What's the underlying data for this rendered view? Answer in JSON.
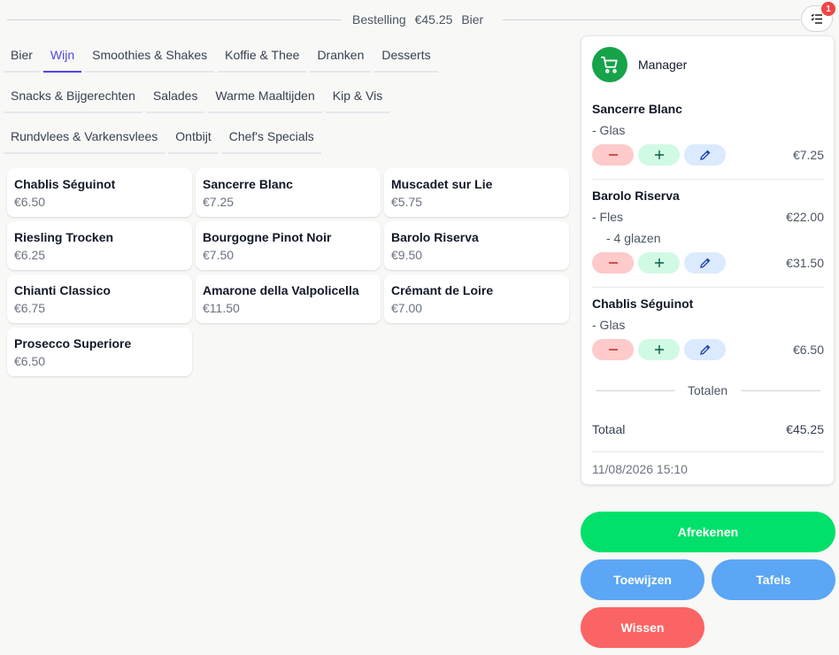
{
  "header": {
    "label": "Bestelling",
    "amount": "€45.25",
    "category": "Bier",
    "badge": "1"
  },
  "tabs": {
    "row1": [
      "Bier",
      "Wijn",
      "Smoothies & Shakes",
      "Koffie & Thee",
      "Dranken",
      "Desserts"
    ],
    "row2": [
      "Snacks & Bijgerechten",
      "Salades",
      "Warme Maaltijden",
      "Kip & Vis"
    ],
    "row3": [
      "Rundvlees & Varkensvlees",
      "Ontbijt",
      "Chef's Specials"
    ],
    "active": "Wijn"
  },
  "products": [
    {
      "name": "Chablis Séguinot",
      "price": "€6.50"
    },
    {
      "name": "Sancerre Blanc",
      "price": "€7.25"
    },
    {
      "name": "Muscadet sur Lie",
      "price": "€5.75"
    },
    {
      "name": "Riesling Trocken",
      "price": "€6.25"
    },
    {
      "name": "Bourgogne Pinot Noir",
      "price": "€7.50"
    },
    {
      "name": "Barolo Riserva",
      "price": "€9.50"
    },
    {
      "name": "Chianti Classico",
      "price": "€6.75"
    },
    {
      "name": "Amarone della Valpolicella",
      "price": "€11.50"
    },
    {
      "name": "Crémant de Loire",
      "price": "€7.00"
    },
    {
      "name": "Prosecco Superiore",
      "price": "€6.50"
    }
  ],
  "order": {
    "user": "Manager",
    "items": [
      {
        "name": "Sancerre Blanc",
        "variant": "- Glas",
        "variant_price": "",
        "extra": "",
        "total": "€7.25"
      },
      {
        "name": "Barolo Riserva",
        "variant": "- Fles",
        "variant_price": "€22.00",
        "extra": "- 4 glazen",
        "total": "€31.50"
      },
      {
        "name": "Chablis Séguinot",
        "variant": "- Glas",
        "variant_price": "",
        "extra": "",
        "total": "€6.50"
      }
    ],
    "totals_heading": "Totalen",
    "total_label": "Totaal",
    "total_value": "€45.25",
    "datetime": "11/08/2026 15:10"
  },
  "actions": {
    "checkout": "Afrekenen",
    "assign": "Toewijzen",
    "tables": "Tafels",
    "clear": "Wissen"
  },
  "colors": {
    "accent": "#4f46e5",
    "checkout": "#00e06a",
    "blue": "#5ba6f5",
    "red": "#fb6464"
  }
}
